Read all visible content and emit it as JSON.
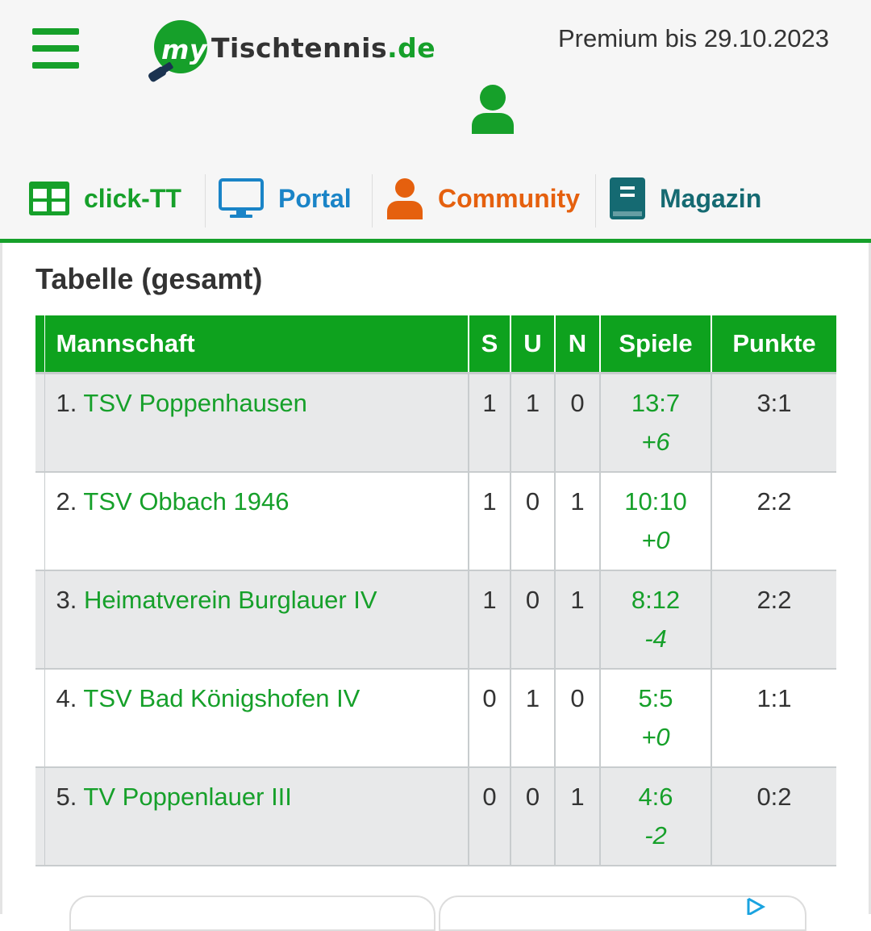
{
  "header": {
    "logo": {
      "prefix": "my",
      "name": "Tischtennis",
      "suffix": ".de"
    },
    "premium_text": "Premium bis 29.10.2023"
  },
  "nav": [
    {
      "label": "click-TT",
      "color": "#16a02a"
    },
    {
      "label": "Portal",
      "color": "#1a84c7"
    },
    {
      "label": "Community",
      "color": "#e5600e"
    },
    {
      "label": "Magazin",
      "color": "#156a72"
    }
  ],
  "section": {
    "title": "Tabelle (gesamt)"
  },
  "table": {
    "headers": {
      "team": "Mannschaft",
      "s": "S",
      "u": "U",
      "n": "N",
      "games": "Spiele",
      "points": "Punkte"
    },
    "rows": [
      {
        "rank": "1.",
        "team": "TSV Poppenhausen",
        "s": "1",
        "u": "1",
        "n": "0",
        "games": "13:7",
        "diff": "+6",
        "points": "3:1"
      },
      {
        "rank": "2.",
        "team": "TSV Obbach 1946",
        "s": "1",
        "u": "0",
        "n": "1",
        "games": "10:10",
        "diff": "+0",
        "points": "2:2"
      },
      {
        "rank": "3.",
        "team": "Heimatverein Burglauer IV",
        "s": "1",
        "u": "0",
        "n": "1",
        "games": "8:12",
        "diff": "-4",
        "points": "2:2"
      },
      {
        "rank": "4.",
        "team": "TSV Bad Königshofen IV",
        "s": "0",
        "u": "1",
        "n": "0",
        "games": "5:5",
        "diff": "+0",
        "points": "1:1"
      },
      {
        "rank": "5.",
        "team": "TV Poppenlauer III",
        "s": "0",
        "u": "0",
        "n": "1",
        "games": "4:6",
        "diff": "-2",
        "points": "0:2"
      }
    ]
  },
  "colors": {
    "brand_green": "#16a02a",
    "header_green": "#0ea21e",
    "row_alt": "#e8e9ea"
  }
}
